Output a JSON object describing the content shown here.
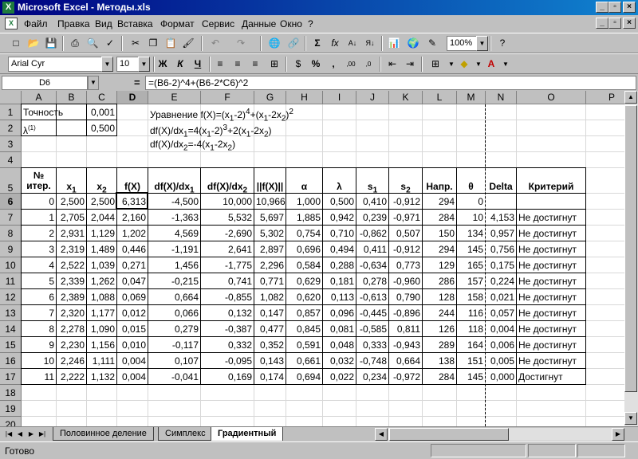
{
  "window": {
    "title": "Microsoft Excel - Методы.xls",
    "app_icon": "X"
  },
  "menu": [
    "Файл",
    "Правка",
    "Вид",
    "Вставка",
    "Формат",
    "Сервис",
    "Данные",
    "Окно",
    "?"
  ],
  "toolbar": {
    "zoom": "100%",
    "font": "Arial Cyr",
    "size": "10"
  },
  "formula_bar": {
    "cell": "D6",
    "eq": "=",
    "formula": "=(B6-2)^4+(B6-2*C6)^2"
  },
  "columns": [
    "A",
    "B",
    "C",
    "D",
    "E",
    "F",
    "G",
    "H",
    "I",
    "J",
    "K",
    "L",
    "M",
    "N",
    "O",
    "P"
  ],
  "rows": [
    "1",
    "2",
    "3",
    "4",
    "5",
    "6",
    "7",
    "8",
    "9",
    "10",
    "11",
    "12",
    "13",
    "14",
    "15",
    "16",
    "17",
    "18",
    "19",
    "20",
    "21",
    "22",
    "23"
  ],
  "info": {
    "a1": "Точность",
    "c1": "0,001",
    "a2": "λ",
    "a2_sup": "(1)",
    "c2": "0,500",
    "e1": "Уравнение f(X)=(x1-2)4+(x1-2x2)2",
    "e2": "df(X)/dx1=4(x1-2)3+2(x1-2x2)",
    "e3": "df(X)/dx2=-4(x1-2x2)"
  },
  "header": {
    "iter1": "№",
    "iter2": "итер.",
    "x1": "x",
    "x1_sub": "1",
    "x2": "x",
    "x2_sub": "2",
    "fx": "f(X)",
    "dfdx1": "df(X)/dx",
    "dfdx1_sub": "1",
    "dfdx2": "df(X)/dx",
    "dfdx2_sub": "2",
    "norm": "||f(X)||",
    "alpha": "α",
    "lambda": "λ",
    "s1": "s",
    "s1_sub": "1",
    "s2": "s",
    "s2_sub": "2",
    "dir": "Напр.",
    "theta": "θ",
    "delta": "Delta",
    "crit": "Критерий"
  },
  "table": [
    [
      "0",
      "2,500",
      "2,500",
      "6,313",
      "-4,500",
      "10,000",
      "10,966",
      "1,000",
      "0,500",
      "0,410",
      "-0,912",
      "294",
      "0",
      "",
      ""
    ],
    [
      "1",
      "2,705",
      "2,044",
      "2,160",
      "-1,363",
      "5,532",
      "5,697",
      "1,885",
      "0,942",
      "0,239",
      "-0,971",
      "284",
      "10",
      "4,153",
      "Не достигнут"
    ],
    [
      "2",
      "2,931",
      "1,129",
      "1,202",
      "4,569",
      "-2,690",
      "5,302",
      "0,754",
      "0,710",
      "-0,862",
      "0,507",
      "150",
      "134",
      "0,957",
      "Не достигнут"
    ],
    [
      "3",
      "2,319",
      "1,489",
      "0,446",
      "-1,191",
      "2,641",
      "2,897",
      "0,696",
      "0,494",
      "0,411",
      "-0,912",
      "294",
      "145",
      "0,756",
      "Не достигнут"
    ],
    [
      "4",
      "2,522",
      "1,039",
      "0,271",
      "1,456",
      "-1,775",
      "2,296",
      "0,584",
      "0,288",
      "-0,634",
      "0,773",
      "129",
      "165",
      "0,175",
      "Не достигнут"
    ],
    [
      "5",
      "2,339",
      "1,262",
      "0,047",
      "-0,215",
      "0,741",
      "0,771",
      "0,629",
      "0,181",
      "0,278",
      "-0,960",
      "286",
      "157",
      "0,224",
      "Не достигнут"
    ],
    [
      "6",
      "2,389",
      "1,088",
      "0,069",
      "0,664",
      "-0,855",
      "1,082",
      "0,620",
      "0,113",
      "-0,613",
      "0,790",
      "128",
      "158",
      "0,021",
      "Не достигнут"
    ],
    [
      "7",
      "2,320",
      "1,177",
      "0,012",
      "0,066",
      "0,132",
      "0,147",
      "0,857",
      "0,096",
      "-0,445",
      "-0,896",
      "244",
      "116",
      "0,057",
      "Не достигнут"
    ],
    [
      "8",
      "2,278",
      "1,090",
      "0,015",
      "0,279",
      "-0,387",
      "0,477",
      "0,845",
      "0,081",
      "-0,585",
      "0,811",
      "126",
      "118",
      "0,004",
      "Не достигнут"
    ],
    [
      "9",
      "2,230",
      "1,156",
      "0,010",
      "-0,117",
      "0,332",
      "0,352",
      "0,591",
      "0,048",
      "0,333",
      "-0,943",
      "289",
      "164",
      "0,006",
      "Не достигнут"
    ],
    [
      "10",
      "2,246",
      "1,111",
      "0,004",
      "0,107",
      "-0,095",
      "0,143",
      "0,661",
      "0,032",
      "-0,748",
      "0,664",
      "138",
      "151",
      "0,005",
      "Не достигнут"
    ],
    [
      "11",
      "2,222",
      "1,132",
      "0,004",
      "-0,041",
      "0,169",
      "0,174",
      "0,694",
      "0,022",
      "0,234",
      "-0,972",
      "284",
      "145",
      "0,000",
      "Достигнут"
    ]
  ],
  "sheets": [
    "Половинное деление",
    "Симплекс",
    "Градиентный"
  ],
  "status": "Готово"
}
